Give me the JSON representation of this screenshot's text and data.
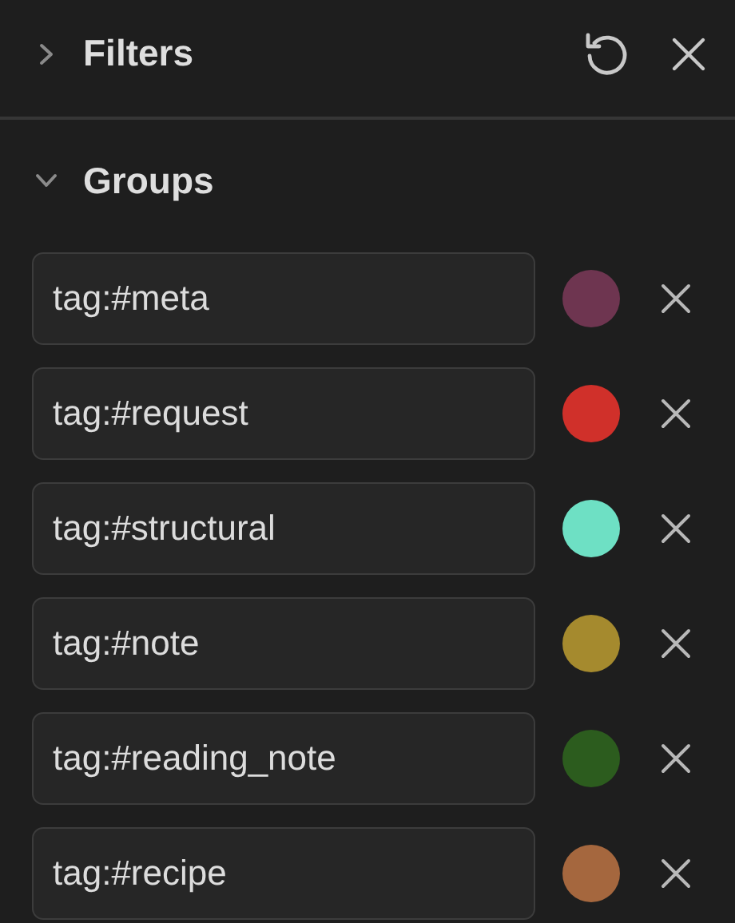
{
  "filters": {
    "title": "Filters",
    "expanded": false
  },
  "groups": {
    "title": "Groups",
    "expanded": true,
    "items": [
      {
        "query": "tag:#meta",
        "color": "#6e3550"
      },
      {
        "query": "tag:#request",
        "color": "#d0302a"
      },
      {
        "query": "tag:#structural",
        "color": "#6ee0c4"
      },
      {
        "query": "tag:#note",
        "color": "#a58a2e"
      },
      {
        "query": "tag:#reading_note",
        "color": "#2c5c1e"
      },
      {
        "query": "tag:#recipe",
        "color": "#a5673e"
      }
    ]
  }
}
